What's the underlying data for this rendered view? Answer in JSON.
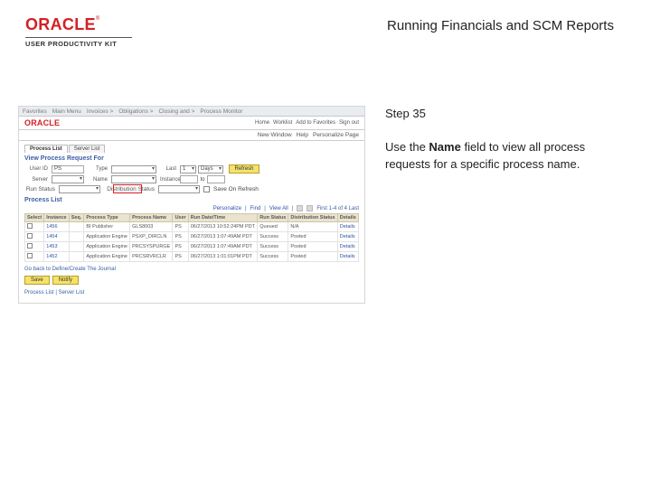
{
  "header": {
    "logo_text": "ORACLE",
    "logo_tm": "®",
    "logo_subtitle": "USER PRODUCTIVITY KIT",
    "page_title": "Running Financials and SCM Reports"
  },
  "instruction": {
    "step_label": "Step 35",
    "text_prefix": "Use the ",
    "bold_word": "Name",
    "text_suffix": " field to view all process requests for a specific process name."
  },
  "app": {
    "topband_items": [
      "Favorites",
      "Main Menu",
      "Invoices >",
      "Obligations >",
      "Closing and >",
      "Process Monitor"
    ],
    "logo": "ORACLE",
    "nav_items": [
      "Home",
      "Worklist",
      "Add to Favorites",
      "Sign out"
    ],
    "orabar_items": [
      "New Window",
      "Help",
      "Personalize Page"
    ],
    "tabs": [
      "Process List",
      "Server List"
    ],
    "report_list_title": "View Process Request For",
    "form": {
      "user_label": "User ID",
      "user_value": "PS",
      "type_label": "Type",
      "last_label": "Last",
      "last_value": "1",
      "last_unit": "Days",
      "refresh": "Refresh",
      "server_label": "Server",
      "name_label": "Name",
      "instance_label": "Instance",
      "to_label": "to",
      "run_status_label": "Run Status",
      "dist_status_label": "Distribution Status",
      "save_check": "Save On Refresh"
    },
    "process_list_title": "Process List",
    "find_bar": {
      "personalize": "Personalize",
      "find": "Find",
      "view_all": "View All",
      "range": "First 1-4 of 4 Last"
    },
    "table": {
      "headers": [
        "Select",
        "Instance",
        "Seq.",
        "Process Type",
        "Process Name",
        "User",
        "Run Date/Time",
        "Run Status",
        "Distribution Status",
        "Details"
      ],
      "rows": [
        {
          "instance": "1456",
          "seq": "",
          "type": "BI Publisher",
          "name": "GLS8003",
          "user": "PS",
          "date": "06/27/2013 10:52:24PM PDT",
          "run": "Queued",
          "dist": "N/A",
          "details": "Details"
        },
        {
          "instance": "1454",
          "seq": "",
          "type": "Application Engine",
          "name": "PSXP_DIRCLN",
          "user": "PS",
          "date": "06/27/2013 1:07:49AM PDT",
          "run": "Success",
          "dist": "Posted",
          "details": "Details"
        },
        {
          "instance": "1453",
          "seq": "",
          "type": "Application Engine",
          "name": "PRCSYSPURGE",
          "user": "PS",
          "date": "06/27/2013 1:07:49AM PDT",
          "run": "Success",
          "dist": "Posted",
          "details": "Details"
        },
        {
          "instance": "1452",
          "seq": "",
          "type": "Application Engine",
          "name": "PRCSRVRCLR",
          "user": "PS",
          "date": "06/27/2013 1:01:01PM PDT",
          "run": "Success",
          "dist": "Posted",
          "details": "Details"
        }
      ]
    },
    "schedule_line": "Go back to Define/Create The Journal",
    "buttons": {
      "save": "Save",
      "notify": "Notify"
    },
    "reports_line": "Process List | Server List"
  }
}
